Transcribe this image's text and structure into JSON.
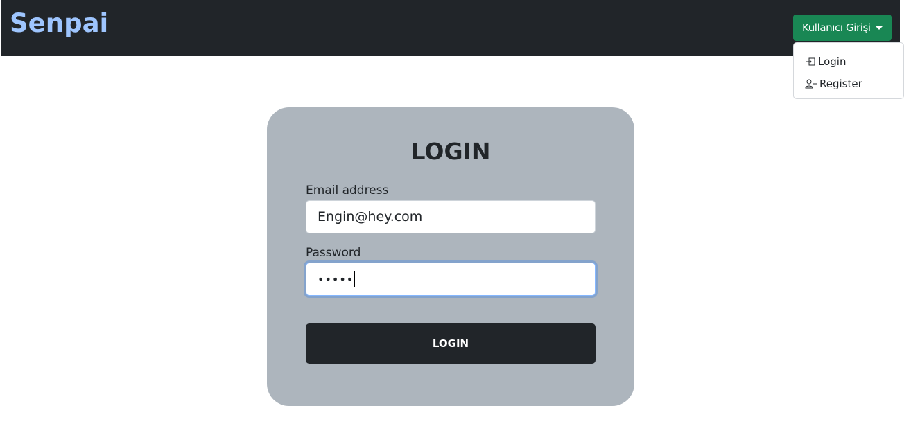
{
  "navbar": {
    "brand": "Senpai",
    "dropdown": {
      "label": "Kullanıcı Girişi",
      "items": [
        {
          "label": "Login",
          "icon": "login-icon"
        },
        {
          "label": "Register",
          "icon": "person-plus-icon"
        }
      ]
    }
  },
  "login_card": {
    "title": "LOGIN",
    "email": {
      "label": "Email address",
      "value": "Engin@hey.com"
    },
    "password": {
      "label": "Password",
      "masked_value": "•••••"
    },
    "submit_label": "LOGIN"
  },
  "colors": {
    "navbar_bg": "#212529",
    "brand": "#9ec5fe",
    "dropdown_button": "#198754",
    "card_bg": "#adb5bd",
    "submit_bg": "#212529",
    "focus_ring": "#86b7fe"
  }
}
